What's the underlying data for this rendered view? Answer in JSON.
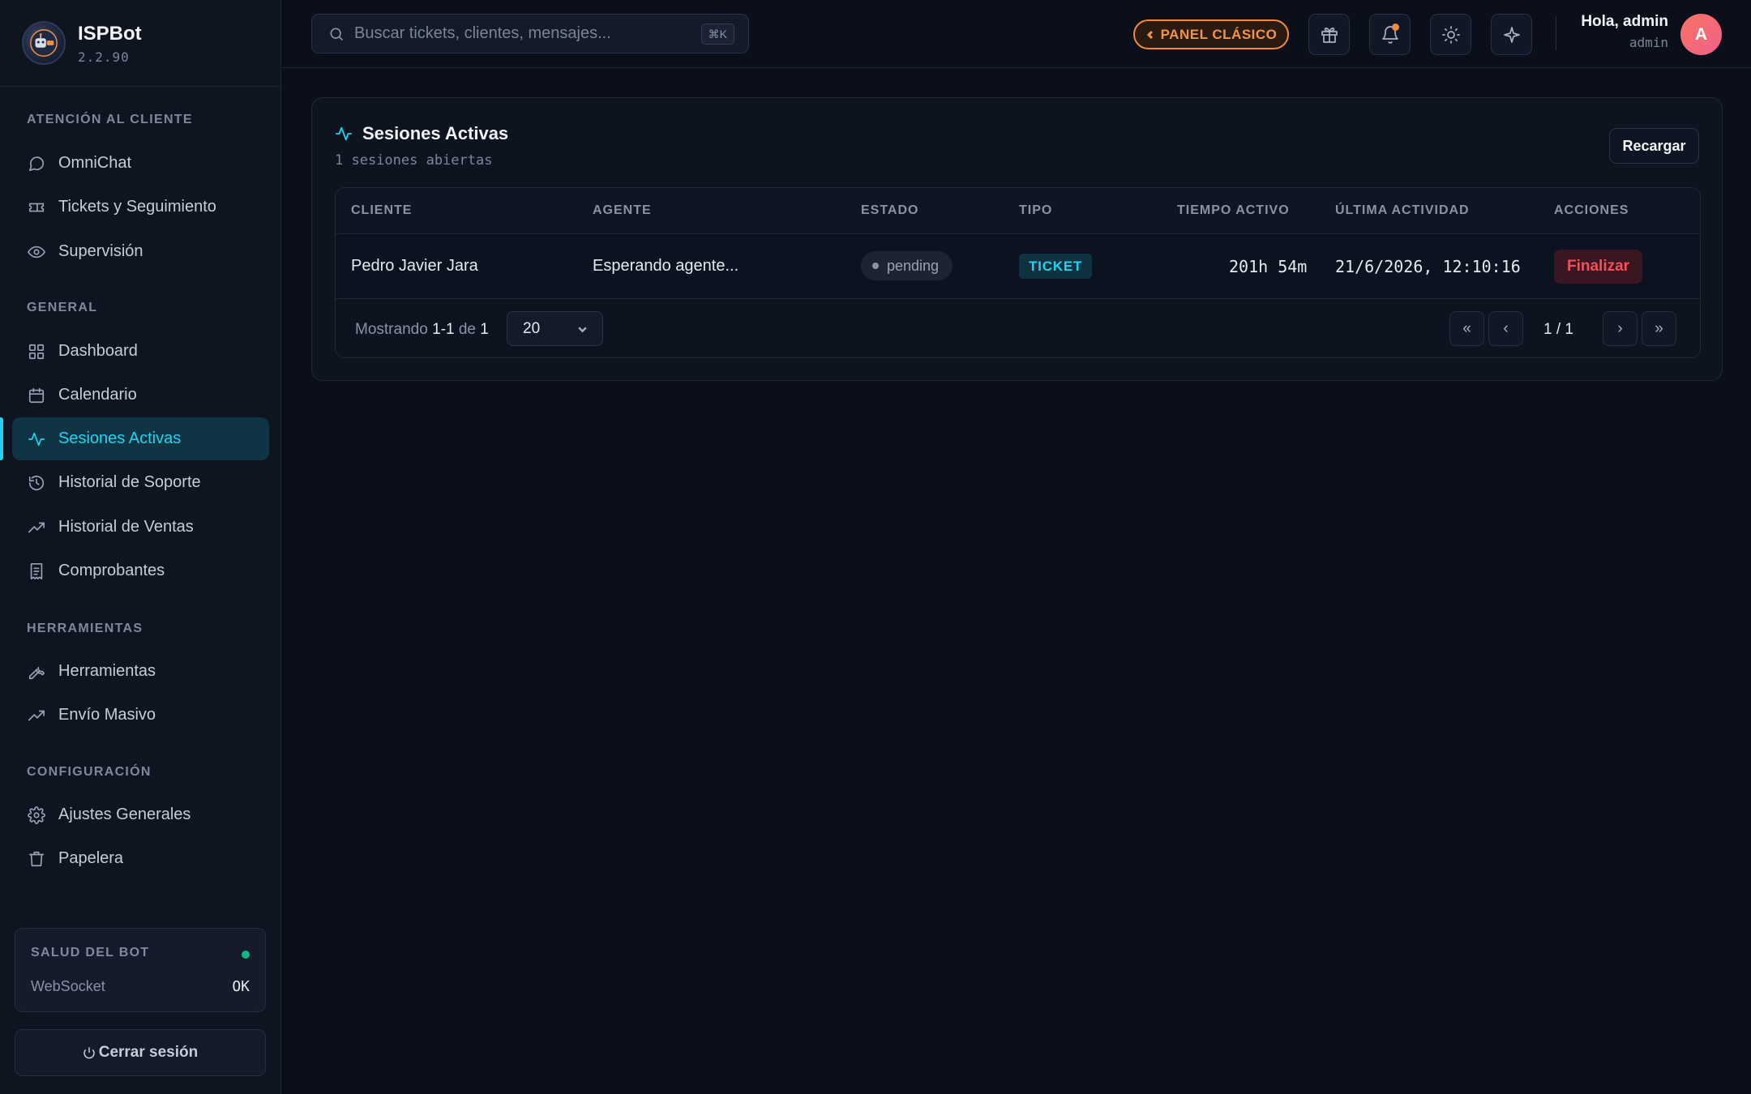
{
  "brand": {
    "name": "ISPBot",
    "version": "2.2.90"
  },
  "sidebar": {
    "sections": [
      {
        "title": "ATENCIÓN AL CLIENTE",
        "items": [
          {
            "label": "OmniChat",
            "icon": "chat-bubble-icon"
          },
          {
            "label": "Tickets y Seguimiento",
            "icon": "ticket-icon"
          },
          {
            "label": "Supervisión",
            "icon": "eye-icon"
          }
        ]
      },
      {
        "title": "GENERAL",
        "items": [
          {
            "label": "Dashboard",
            "icon": "grid-icon"
          },
          {
            "label": "Calendario",
            "icon": "calendar-icon"
          },
          {
            "label": "Sesiones Activas",
            "icon": "activity-icon",
            "active": true
          },
          {
            "label": "Historial de Soporte",
            "icon": "history-icon"
          },
          {
            "label": "Historial de Ventas",
            "icon": "trending-up-icon"
          },
          {
            "label": "Comprobantes",
            "icon": "receipt-icon"
          }
        ]
      },
      {
        "title": "HERRAMIENTAS",
        "items": [
          {
            "label": "Herramientas",
            "icon": "wrench-icon"
          },
          {
            "label": "Envío Masivo",
            "icon": "trending-up-icon"
          }
        ]
      },
      {
        "title": "CONFIGURACIÓN",
        "items": [
          {
            "label": "Ajustes Generales",
            "icon": "gear-icon"
          },
          {
            "label": "Papelera",
            "icon": "trash-icon"
          }
        ]
      }
    ],
    "health": {
      "title": "SALUD DEL BOT",
      "label": "WebSocket",
      "value": "OK",
      "status_color": "#10b981"
    },
    "logout_label": "Cerrar sesión"
  },
  "topbar": {
    "search_placeholder": "Buscar tickets, clientes, mensajes...",
    "shortcut": "⌘K",
    "classic_label": "PANEL CLÁSICO",
    "greeting": "Hola, admin",
    "role": "admin",
    "avatar_initial": "A"
  },
  "sessions": {
    "title": "Sesiones Activas",
    "subtitle": "1 sesiones abiertas",
    "reload_label": "Recargar",
    "columns": {
      "cliente": "CLIENTE",
      "agente": "AGENTE",
      "estado": "ESTADO",
      "tipo": "TIPO",
      "tiempo": "TIEMPO ACTIVO",
      "ultima": "ÚLTIMA ACTIVIDAD",
      "acciones": "ACCIONES"
    },
    "rows": [
      {
        "cliente": "Pedro Javier Jara",
        "agente": "Esperando agente...",
        "estado": "pending",
        "tipo": "TICKET",
        "tiempo": "201h 54m",
        "ultima": "21/6/2026, 12:10:16",
        "accion": "Finalizar"
      }
    ],
    "footer": {
      "showing_prefix": "Mostrando",
      "range": "1-1",
      "of": "de",
      "total": "1",
      "per_page": "20",
      "page_info": "1 / 1",
      "first": "«",
      "prev": "‹",
      "next": "›",
      "last": "»"
    }
  },
  "colors": {
    "accent": "#22d3ee",
    "warning": "#f08a3c",
    "danger": "#f0515a",
    "background": "#0b0f19"
  }
}
